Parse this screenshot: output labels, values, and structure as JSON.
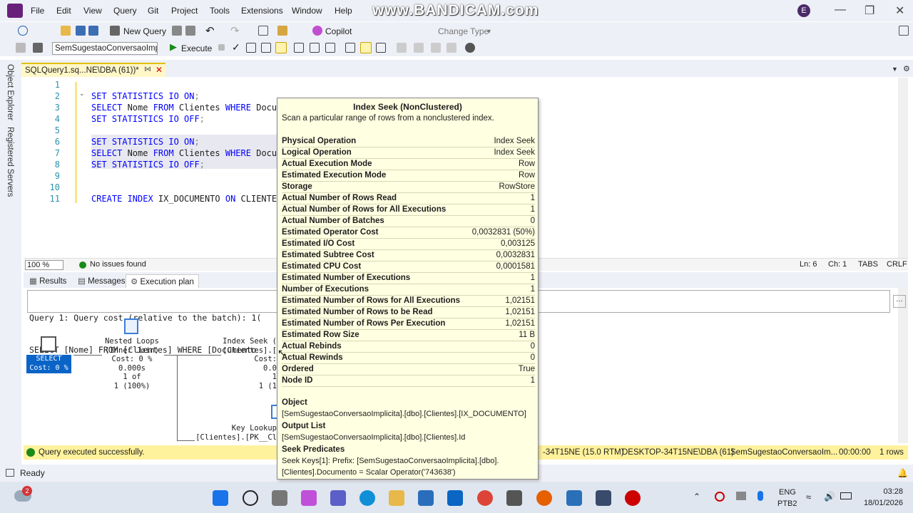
{
  "menu": {
    "items": [
      "File",
      "Edit",
      "View",
      "Query",
      "Git",
      "Project",
      "Tools",
      "Extensions",
      "Window",
      "Help"
    ]
  },
  "watermark": "www.BANDICAM.com",
  "user_initial": "E",
  "toolbar1": {
    "new_query": "New Query",
    "copilot": "Copilot",
    "change_type": "Change Type"
  },
  "toolbar2": {
    "database": "SemSugestaoConversaoImp",
    "execute": "Execute"
  },
  "side_tabs": [
    "Object Explorer",
    "Registered Servers"
  ],
  "doc_tab": {
    "label": "SQLQuery1.sq...NE\\DBA (61))*"
  },
  "editor": {
    "line_numbers": [
      "1",
      "2",
      "3",
      "4",
      "5",
      "6",
      "7",
      "8",
      "9",
      "10",
      "11"
    ],
    "lines": [
      {
        "p": []
      },
      {
        "p": [
          {
            "t": "SET STATISTICS IO ",
            "c": "kw"
          },
          {
            "t": "ON",
            "c": "kw"
          },
          {
            "t": ";",
            "c": "gr"
          }
        ]
      },
      {
        "p": [
          {
            "t": "SELECT ",
            "c": "kw"
          },
          {
            "t": "Nome ",
            "c": ""
          },
          {
            "t": "FROM ",
            "c": "kw"
          },
          {
            "t": "Clientes ",
            "c": ""
          },
          {
            "t": "WHERE ",
            "c": "kw"
          },
          {
            "t": "Docum",
            "c": ""
          }
        ]
      },
      {
        "p": [
          {
            "t": "SET STATISTICS IO ",
            "c": "kw"
          },
          {
            "t": "OFF",
            "c": "kw"
          },
          {
            "t": ";",
            "c": "gr"
          }
        ]
      },
      {
        "p": []
      },
      {
        "p": [
          {
            "t": "SET STATISTICS IO ",
            "c": "kw"
          },
          {
            "t": "ON",
            "c": "kw"
          },
          {
            "t": ";",
            "c": "gr"
          }
        ]
      },
      {
        "p": [
          {
            "t": "SELECT ",
            "c": "kw"
          },
          {
            "t": "Nome ",
            "c": ""
          },
          {
            "t": "FROM ",
            "c": "kw"
          },
          {
            "t": "Clientes ",
            "c": ""
          },
          {
            "t": "WHERE ",
            "c": "kw"
          },
          {
            "t": "Docu",
            "c": ""
          }
        ]
      },
      {
        "p": [
          {
            "t": "SET STATISTICS IO ",
            "c": "kw"
          },
          {
            "t": "OFF",
            "c": "kw"
          },
          {
            "t": ";",
            "c": "gr"
          }
        ]
      },
      {
        "p": []
      },
      {
        "p": []
      },
      {
        "p": [
          {
            "t": "CREATE INDEX ",
            "c": "kw"
          },
          {
            "t": "IX_DOCUMENTO ",
            "c": ""
          },
          {
            "t": "ON ",
            "c": "kw"
          },
          {
            "t": "CLIENTES",
            "c": ""
          }
        ]
      }
    ],
    "zoom": "100 %",
    "issues": "No issues found",
    "ln": "Ln: 6",
    "ch": "Ch: 1",
    "tabs": "TABS",
    "crlf": "CRLF"
  },
  "results_tabs": [
    "Results",
    "Messages",
    "Execution plan"
  ],
  "plan": {
    "header_line1": "Query 1: Query cost (relative to the batch): 1(",
    "header_line2": "SELECT [Nome] FROM [Clientes] WHERE [Documento",
    "select_node": {
      "label": "SELECT",
      "cost": "Cost: 0 %"
    },
    "nested_loops": {
      "text": "Nested Loops\n(Inner Join)\nCost: 0 %\n0.000s\n1 of\n1 (100%)"
    },
    "index_seek": {
      "text": "Index Seek (\n[Clientes].[\nCost:\n0.0\n1\n1 (1"
    },
    "key_lookup": {
      "text": "Key Lookup\n[Clientes].[PK__Cl"
    }
  },
  "query_status": {
    "message": "Query executed successfully.",
    "server": "-34T15NE (15.0 RTM)",
    "login": "DESKTOP-34T15NE\\DBA (61)",
    "db": "SemSugestaoConversaoIm...",
    "time": "00:00:00",
    "rows": "1 rows"
  },
  "status": {
    "ready": "Ready"
  },
  "taskbar": {
    "badge": "2",
    "lang1": "ENG",
    "lang2": "PTB2",
    "time": "03:28",
    "date": "18/01/2026"
  },
  "tooltip": {
    "title": "Index Seek (NonClustered)",
    "description": "Scan a particular range of rows from a nonclustered index.",
    "props": [
      {
        "k": "Physical Operation",
        "v": "Index Seek"
      },
      {
        "k": "Logical Operation",
        "v": "Index Seek"
      },
      {
        "k": "Actual Execution Mode",
        "v": "Row"
      },
      {
        "k": "Estimated Execution Mode",
        "v": "Row"
      },
      {
        "k": "Storage",
        "v": "RowStore"
      },
      {
        "k": "Actual Number of Rows Read",
        "v": "1"
      },
      {
        "k": "Actual Number of Rows for All Executions",
        "v": "1"
      },
      {
        "k": "Actual Number of Batches",
        "v": "0"
      },
      {
        "k": "Estimated Operator Cost",
        "v": "0,0032831 (50%)"
      },
      {
        "k": "Estimated I/O Cost",
        "v": "0,003125"
      },
      {
        "k": "Estimated Subtree Cost",
        "v": "0,0032831"
      },
      {
        "k": "Estimated CPU Cost",
        "v": "0,0001581"
      },
      {
        "k": "Estimated Number of Executions",
        "v": "1"
      },
      {
        "k": "Number of Executions",
        "v": "1"
      },
      {
        "k": "Estimated Number of Rows for All Executions",
        "v": "1,02151"
      },
      {
        "k": "Estimated Number of Rows to be Read",
        "v": "1,02151"
      },
      {
        "k": "Estimated Number of Rows Per Execution",
        "v": "1,02151"
      },
      {
        "k": "Estimated Row Size",
        "v": "11 B"
      },
      {
        "k": "Actual Rebinds",
        "v": "0"
      },
      {
        "k": "Actual Rewinds",
        "v": "0"
      },
      {
        "k": "Ordered",
        "v": "True"
      },
      {
        "k": "Node ID",
        "v": "1"
      }
    ],
    "object_label": "Object",
    "object_value": "[SemSugestaoConversaoImplicita].[dbo].[Clientes].[IX_DOCUMENTO]",
    "output_label": "Output List",
    "output_value": "[SemSugestaoConversaoImplicita].[dbo].[Clientes].Id",
    "seek_label": "Seek Predicates",
    "seek_value": "Seek Keys[1]: Prefix: [SemSugestaoConversaoImplicita].[dbo].[Clientes].Documento = Scalar Operator('743638')"
  }
}
